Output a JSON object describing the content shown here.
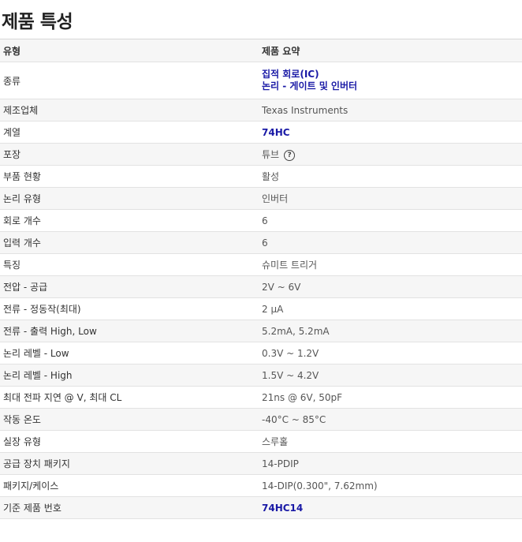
{
  "title": "제품 특성",
  "header": {
    "type_label": "유형",
    "summary_label": "제품 요약"
  },
  "rows": [
    {
      "label": "종류",
      "values": [
        "집적 회로(IC)",
        "논리 - 게이트 및 인버터"
      ],
      "link": true
    },
    {
      "label": "제조업체",
      "value": "Texas Instruments"
    },
    {
      "label": "계열",
      "value": "74HC",
      "link": true
    },
    {
      "label": "포장",
      "value": "튜브",
      "help_icon": "question-circle-icon",
      "help_glyph": "?"
    },
    {
      "label": "부품 현황",
      "value": "활성"
    },
    {
      "label": "논리 유형",
      "value": "인버터"
    },
    {
      "label": "회로 개수",
      "value": "6"
    },
    {
      "label": "입력 개수",
      "value": "6"
    },
    {
      "label": "특징",
      "value": "슈미트 트리거"
    },
    {
      "label": "전압 - 공급",
      "value": "2V ~ 6V"
    },
    {
      "label": "전류 - 정동작(최대)",
      "value": "2 µA"
    },
    {
      "label": "전류 - 출력 High, Low",
      "value": "5.2mA, 5.2mA"
    },
    {
      "label": "논리 레벨 - Low",
      "value": "0.3V ~ 1.2V"
    },
    {
      "label": "논리 레벨 - High",
      "value": "1.5V ~ 4.2V"
    },
    {
      "label": "최대 전파 지연 @ V, 최대 CL",
      "value": "21ns @ 6V, 50pF"
    },
    {
      "label": "작동 온도",
      "value": "-40°C ~ 85°C"
    },
    {
      "label": "실장 유형",
      "value": "스루홀"
    },
    {
      "label": "공급 장치 패키지",
      "value": "14-PDIP"
    },
    {
      "label": "패키지/케이스",
      "value": "14-DIP(0.300\", 7.62mm)"
    },
    {
      "label": "기준 제품 번호",
      "value": "74HC14",
      "link": true
    }
  ],
  "colors": {
    "link": "#1a1aa6",
    "alt_row": "#f6f6f6",
    "border": "#e2e2e2"
  }
}
